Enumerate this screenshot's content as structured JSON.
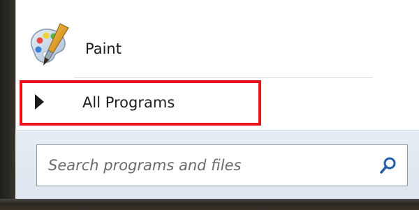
{
  "start_menu": {
    "pinned_items": [
      {
        "label": "Paint",
        "icon": "paint-palette-icon"
      }
    ],
    "all_programs": {
      "label": "All Programs",
      "icon": "right-triangle-arrow-icon"
    },
    "search": {
      "placeholder": "Search programs and files",
      "icon": "search-icon"
    }
  },
  "colors": {
    "highlight_border": "#e8131b",
    "menu_bottom_bg": "#e2e9f1"
  }
}
